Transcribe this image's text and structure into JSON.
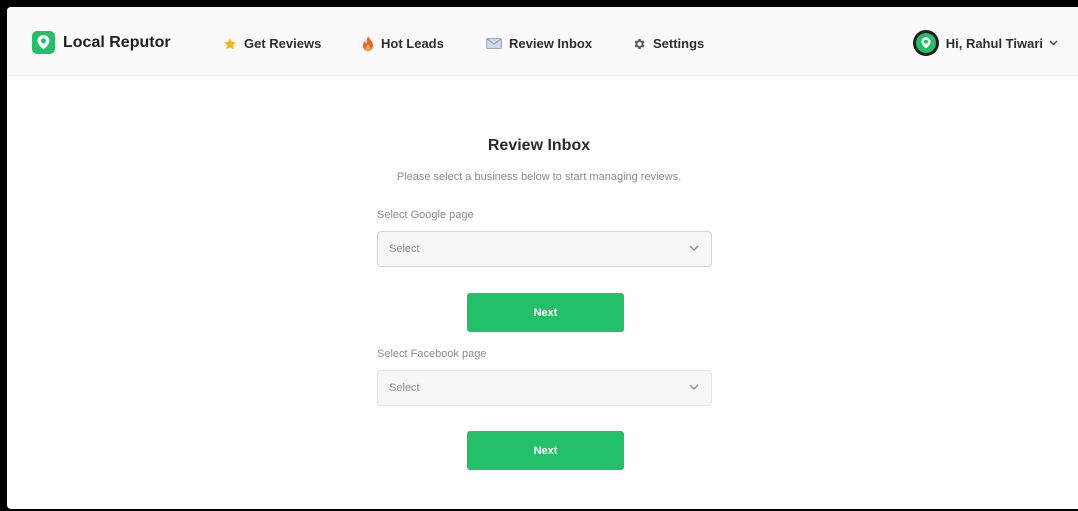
{
  "brand": {
    "name": "Local Reputor",
    "color": "#22c068"
  },
  "nav": {
    "items": [
      {
        "label": "Get Reviews",
        "icon": "star-icon"
      },
      {
        "label": "Hot Leads",
        "icon": "fire-icon"
      },
      {
        "label": "Review Inbox",
        "icon": "inbox-icon"
      },
      {
        "label": "Settings",
        "icon": "gear-icon"
      }
    ]
  },
  "user": {
    "greeting": "Hi, Rahul Tiwari"
  },
  "main": {
    "title": "Review Inbox",
    "subtitle": "Please select a business below to start managing reviews.",
    "google": {
      "label": "Select Google page",
      "value": "Select",
      "button": "Next"
    },
    "facebook": {
      "label": "Select Facebook page",
      "value": "Select",
      "button": "Next"
    }
  }
}
